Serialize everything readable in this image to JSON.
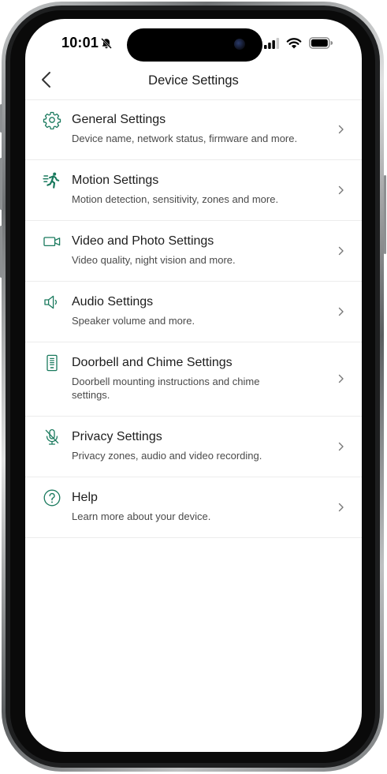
{
  "status_bar": {
    "time": "10:01"
  },
  "header": {
    "title": "Device Settings"
  },
  "colors": {
    "accent_green": "#1a7a5e",
    "text_primary": "#1d1d1d",
    "text_secondary": "#4a4a4a",
    "divider": "#ececec"
  },
  "settings": [
    {
      "title": "General Settings",
      "subtitle": "Device name, network status, firmware and more.",
      "icon": "gear-icon"
    },
    {
      "title": "Motion Settings",
      "subtitle": "Motion detection, sensitivity, zones and more.",
      "icon": "running-person-icon"
    },
    {
      "title": "Video and Photo Settings",
      "subtitle": "Video quality, night vision and more.",
      "icon": "video-camera-icon"
    },
    {
      "title": "Audio Settings",
      "subtitle": "Speaker volume and more.",
      "icon": "speaker-icon"
    },
    {
      "title": "Doorbell and Chime Settings",
      "subtitle": "Doorbell mounting instructions and chime settings.",
      "icon": "doorbell-icon"
    },
    {
      "title": "Privacy Settings",
      "subtitle": "Privacy zones, audio and video recording.",
      "icon": "microphone-off-icon"
    },
    {
      "title": "Help",
      "subtitle": "Learn more about your device.",
      "icon": "help-icon"
    }
  ]
}
